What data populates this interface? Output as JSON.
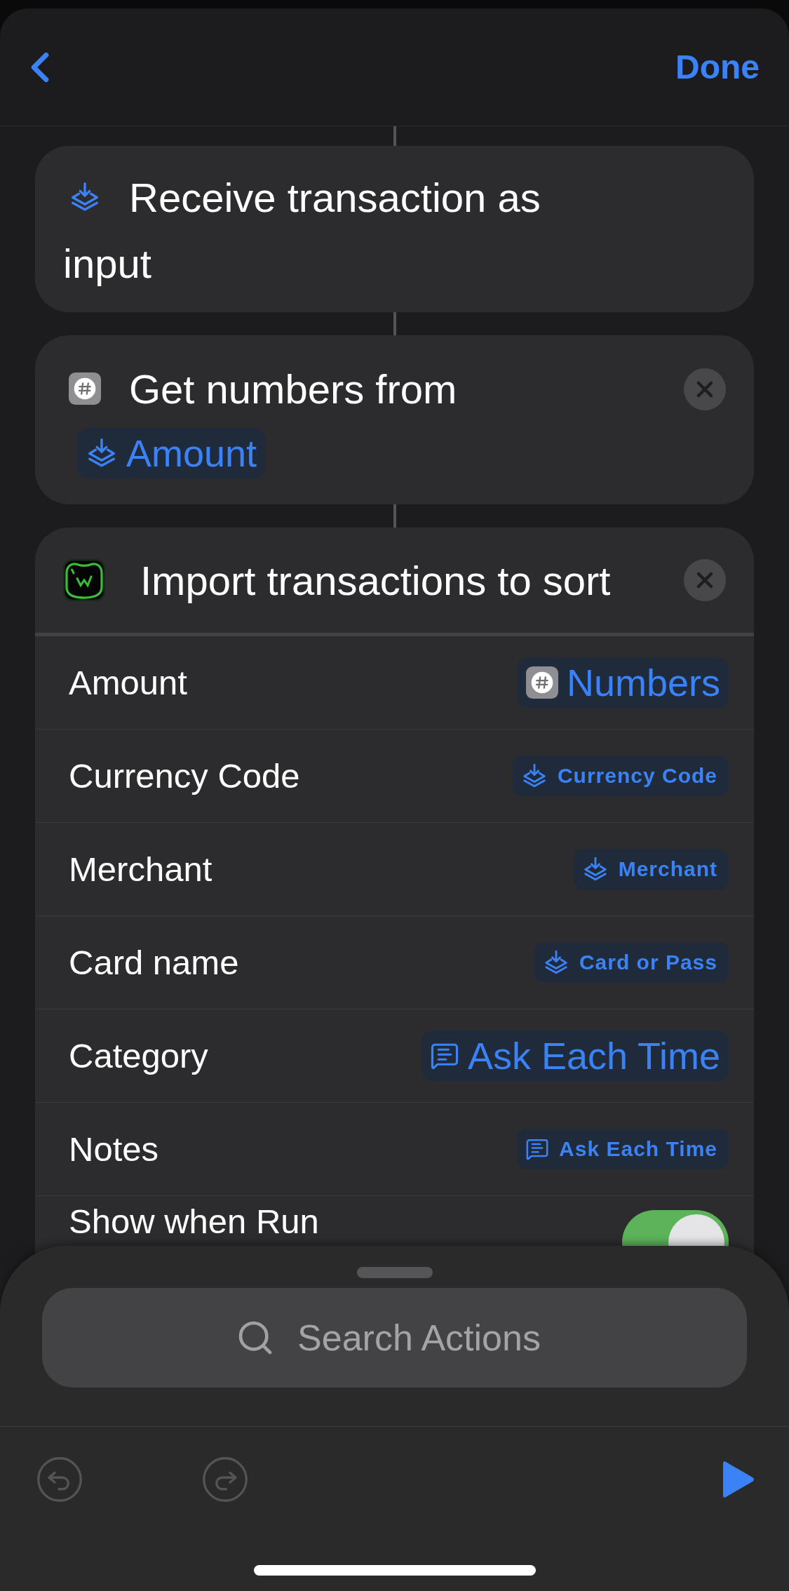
{
  "nav": {
    "done": "Done"
  },
  "actions": [
    {
      "kind": "input",
      "title": "Receive transaction as input",
      "removable": false
    },
    {
      "kind": "number",
      "title": "Get numbers from",
      "removable": true,
      "variable": {
        "kind": "input",
        "label": "Amount",
        "large": true
      }
    },
    {
      "kind": "app",
      "title": "Import transactions to sort",
      "removable": true,
      "parameters": [
        {
          "kind": "variable",
          "label": "Amount",
          "value": {
            "kind": "number",
            "label": "Numbers",
            "large": true
          }
        },
        {
          "kind": "variable",
          "label": "Currency Code",
          "value": {
            "kind": "input",
            "label": "Currency Code",
            "large": false
          }
        },
        {
          "kind": "variable",
          "label": "Merchant",
          "value": {
            "kind": "input",
            "label": "Merchant",
            "large": false
          }
        },
        {
          "kind": "variable",
          "label": "Card name",
          "value": {
            "kind": "input",
            "label": "Card or Pass",
            "large": false
          }
        },
        {
          "kind": "variable",
          "label": "Category",
          "value": {
            "kind": "ask",
            "label": "Ask Each Time",
            "large": true
          }
        },
        {
          "kind": "variable",
          "label": "Notes",
          "value": {
            "kind": "ask",
            "label": "Ask Each Time",
            "large": false
          }
        },
        {
          "kind": "toggle",
          "label": "Show when Run",
          "on": true
        }
      ]
    }
  ],
  "search": {
    "placeholder": "Search Actions"
  },
  "toolbar": {
    "undo": {
      "disabled": true
    },
    "redo": {
      "disabled": true
    },
    "run": {
      "disabled": false
    }
  }
}
